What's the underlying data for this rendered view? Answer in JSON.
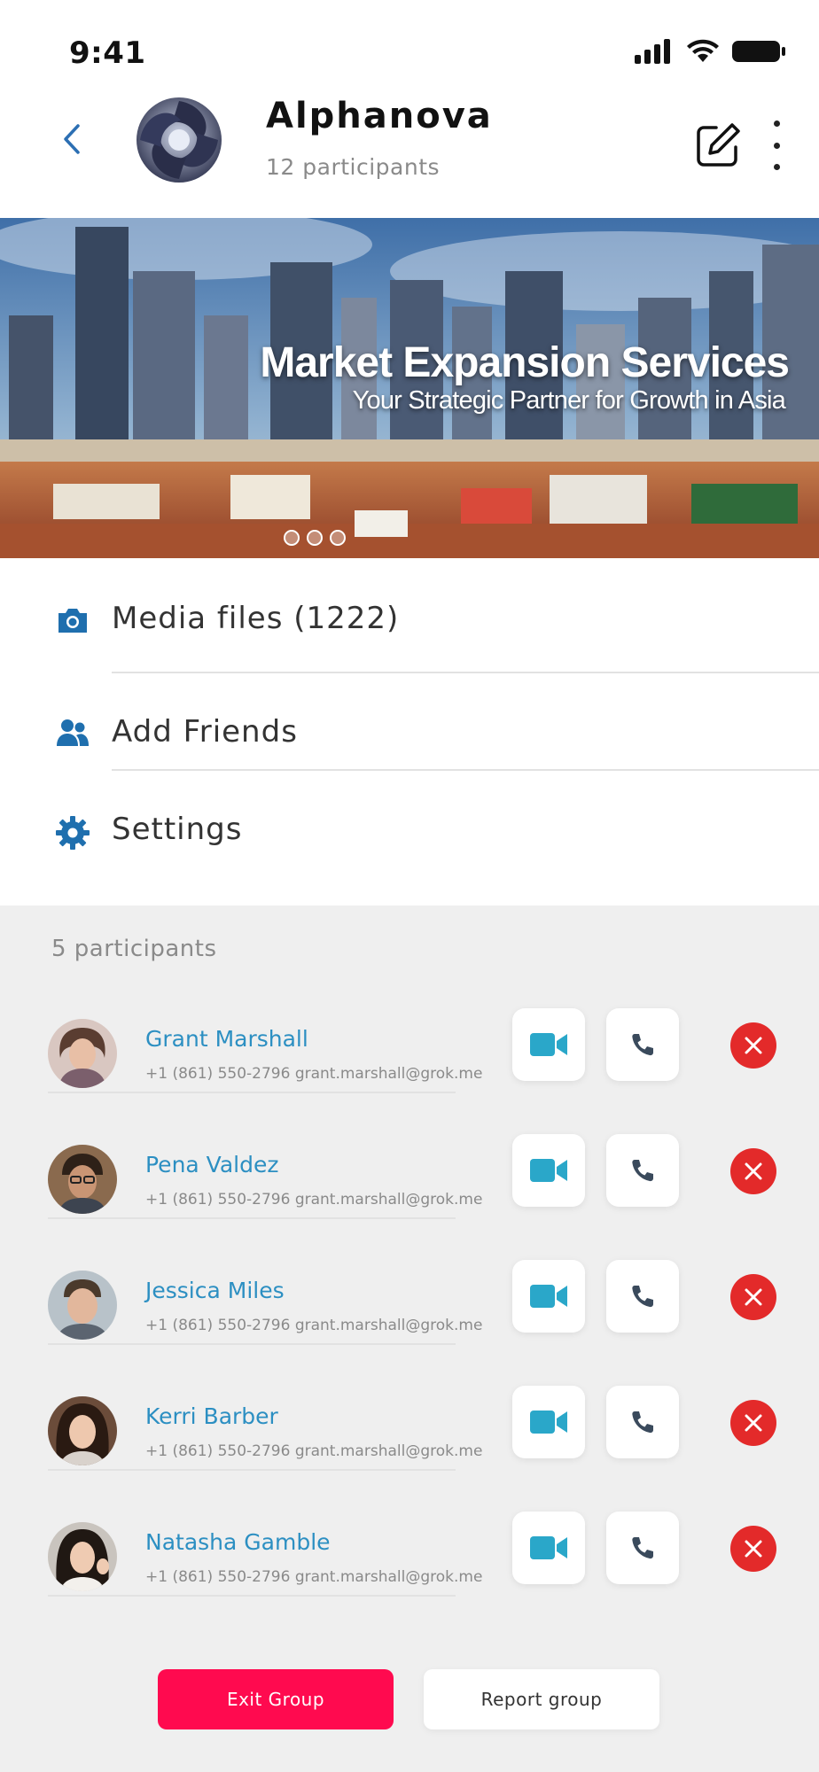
{
  "status_bar": {
    "time": "9:41"
  },
  "header": {
    "title": "Alphanova",
    "subtitle": "12 participants"
  },
  "banner": {
    "title": "Market Expansion Services",
    "subtitle": "Your Strategic Partner for Growth in Asia",
    "slides": 3,
    "active_slide": 1
  },
  "menu": {
    "items": [
      {
        "label": "Media files (1222)",
        "icon": "camera-icon"
      },
      {
        "label": "Add Friends",
        "icon": "users-icon"
      },
      {
        "label": "Settings",
        "icon": "gear-icon"
      }
    ]
  },
  "participants": {
    "count_label": "5 participants",
    "list": [
      {
        "name": "Grant Marshall",
        "info": "+1 (861) 550-2796 grant.marshall@grok.me"
      },
      {
        "name": "Pena Valdez",
        "info": "+1 (861) 550-2796 grant.marshall@grok.me"
      },
      {
        "name": "Jessica Miles",
        "info": "+1 (861) 550-2796 grant.marshall@grok.me"
      },
      {
        "name": "Kerri Barber",
        "info": "+1 (861) 550-2796 grant.marshall@grok.me"
      },
      {
        "name": "Natasha Gamble",
        "info": "+1 (861) 550-2796 grant.marshall@grok.me"
      }
    ]
  },
  "actions": {
    "exit_label": "Exit Group",
    "report_label": "Report group"
  },
  "colors": {
    "accent_blue": "#2c8fc2",
    "icon_blue": "#1f6fae",
    "video_teal": "#2aa7c9",
    "remove_red": "#e32a2a",
    "exit_pink": "#ff0a4f",
    "background": "#efefef"
  }
}
